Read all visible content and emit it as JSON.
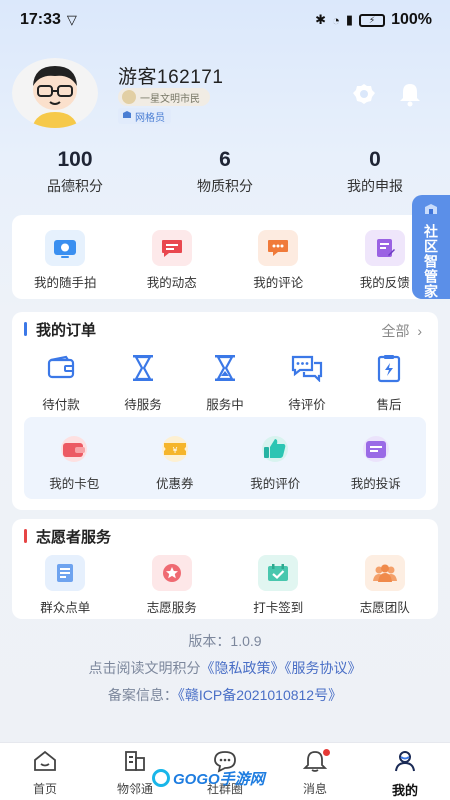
{
  "status_bar": {
    "time": "17:33",
    "battery": "100%"
  },
  "profile": {
    "username": "游客162171",
    "level_badge": "一星文明市民",
    "role_badge": "网格员"
  },
  "stats": [
    {
      "value": "100",
      "label": "品德积分"
    },
    {
      "value": "6",
      "label": "物质积分"
    },
    {
      "value": "0",
      "label": "我的申报"
    }
  ],
  "quick_actions": [
    {
      "label": "我的随手拍",
      "icon": "camera-icon"
    },
    {
      "label": "我的动态",
      "icon": "chat-icon"
    },
    {
      "label": "我的评论",
      "icon": "comment-icon"
    },
    {
      "label": "我的反馈",
      "icon": "feedback-icon"
    }
  ],
  "orders": {
    "title": "我的订单",
    "more_label": "全部",
    "items": [
      {
        "label": "待付款",
        "icon": "wallet-icon"
      },
      {
        "label": "待服务",
        "icon": "hourglass-icon"
      },
      {
        "label": "服务中",
        "icon": "hourglass-icon"
      },
      {
        "label": "待评价",
        "icon": "review-icon"
      },
      {
        "label": "售后",
        "icon": "after-sale-icon"
      }
    ],
    "sub_items": [
      {
        "label": "我的卡包",
        "icon": "card-wallet-icon"
      },
      {
        "label": "优惠券",
        "icon": "coupon-icon"
      },
      {
        "label": "我的评价",
        "icon": "thumb-up-icon"
      },
      {
        "label": "我的投诉",
        "icon": "complaint-icon"
      }
    ]
  },
  "volunteer": {
    "title": "志愿者服务",
    "items": [
      {
        "label": "群众点单",
        "icon": "order-list-icon"
      },
      {
        "label": "志愿服务",
        "icon": "star-icon"
      },
      {
        "label": "打卡签到",
        "icon": "checkin-icon"
      },
      {
        "label": "志愿团队",
        "icon": "team-icon"
      }
    ]
  },
  "footer": {
    "version": "版本：1.0.9",
    "agreement_prefix": "点击阅读文明积分",
    "privacy_link": "《隐私政策》",
    "service_link": "《服务协议》",
    "icp_prefix": "备案信息：",
    "icp_link": "《赣ICP备2021010812号》"
  },
  "float_tag": {
    "label": "社区智管家"
  },
  "tabs": [
    {
      "label": "首页",
      "icon": "home-icon",
      "active": false
    },
    {
      "label": "物邻通",
      "icon": "building-icon",
      "active": false
    },
    {
      "label": "社群圈",
      "icon": "chat-bubble-icon",
      "active": false
    },
    {
      "label": "消息",
      "icon": "bell-icon",
      "active": false
    },
    {
      "label": "我的",
      "icon": "user-icon",
      "active": true
    }
  ],
  "watermark": {
    "text": "GOGO手游网"
  },
  "colors": {
    "accent": "#3b78e7",
    "red_accent": "#e64545",
    "link": "#4a6fc6"
  }
}
